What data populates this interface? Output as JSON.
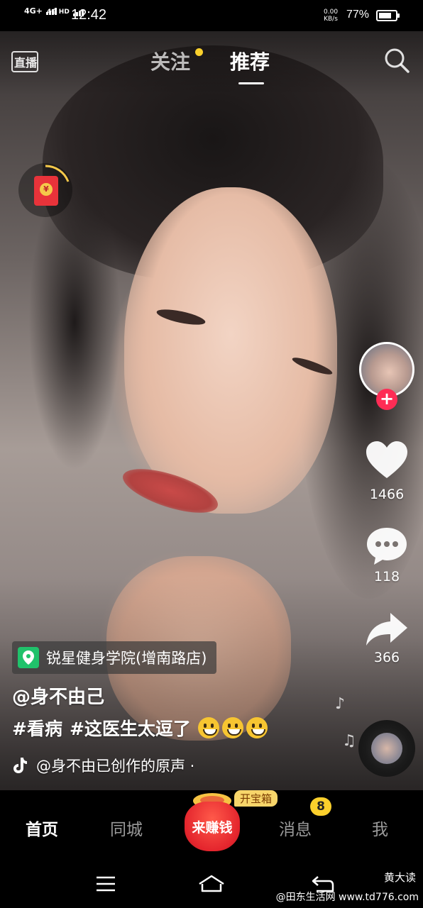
{
  "status_bar": {
    "network1": "4G+",
    "network2": "4G HD",
    "time": "12:42",
    "net_speed_value": "0.00",
    "net_speed_unit": "KB/s",
    "battery_percent": "77%",
    "battery_level": 0.77
  },
  "top_nav": {
    "live_label": "直播",
    "tabs": [
      {
        "label": "关注",
        "has_dot": true,
        "active": false
      },
      {
        "label": "推荐",
        "active": true
      }
    ]
  },
  "right_rail": {
    "like_count": "1466",
    "comment_count": "118",
    "share_count": "366"
  },
  "caption": {
    "location": "锐星健身学院(增南路店)",
    "author": "@身不由己",
    "hashtags": [
      "#看病",
      "#这医生太逗了"
    ],
    "emoji_count": 3,
    "music": "@身不由已创作的原声 ·"
  },
  "tabbar": {
    "items": [
      "首页",
      "同城",
      "消息",
      "我"
    ],
    "active": "首页",
    "center_label": "来赚钱",
    "chest_tag": "开宝箱",
    "message_badge": "8"
  },
  "watermark": {
    "line1": "黄大读",
    "line2": "@田东生活网 www.td776.com"
  },
  "colors": {
    "accent_pink": "#fe2c55",
    "badge_yellow": "#fbd02c",
    "poi_green": "#20c26b"
  }
}
